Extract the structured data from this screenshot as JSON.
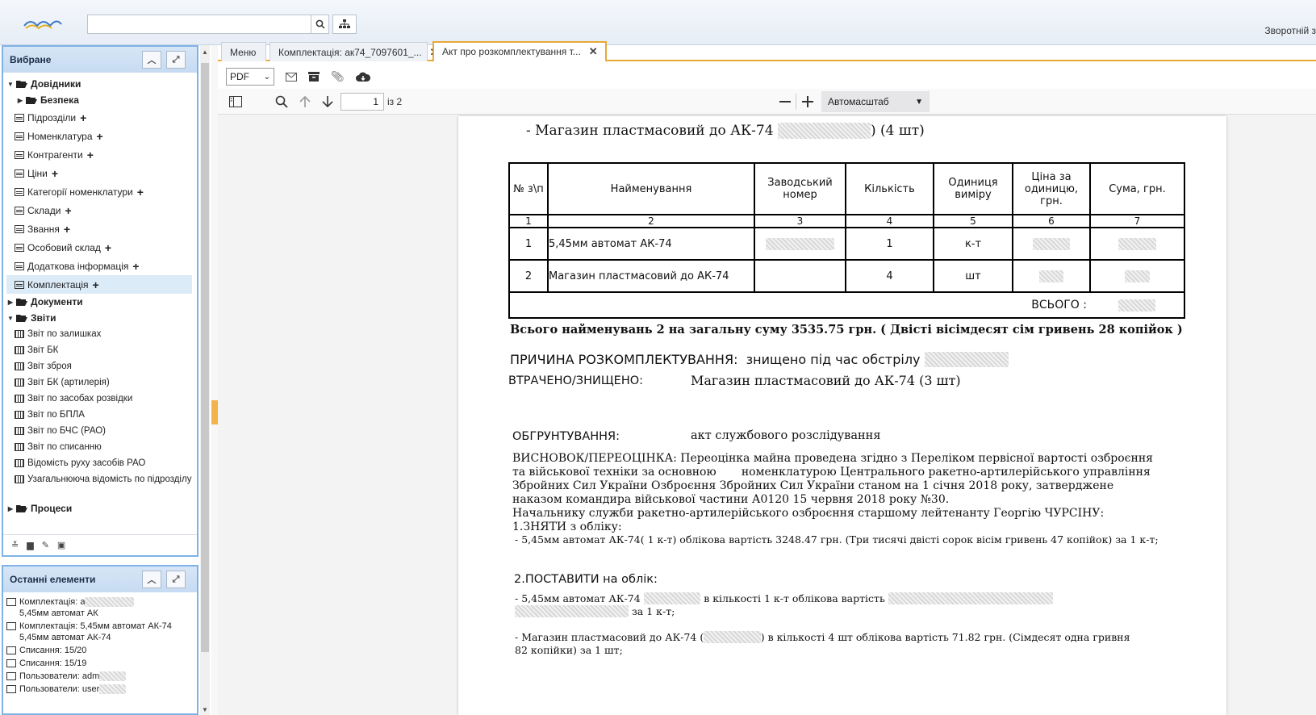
{
  "header": {
    "search_placeholder": "",
    "feedback_label": "Зворотній з"
  },
  "favorites": {
    "title": "Вибране",
    "items": [
      {
        "label": "Довідники"
      },
      {
        "label": "Безпека"
      },
      {
        "label": "Підрозділи"
      },
      {
        "label": "Номенклатура"
      },
      {
        "label": "Контрагенти"
      },
      {
        "label": "Ціни"
      },
      {
        "label": "Категорії номенклатури"
      },
      {
        "label": "Склади"
      },
      {
        "label": "Звання"
      },
      {
        "label": "Особовий склад"
      },
      {
        "label": "Додаткова інформація"
      },
      {
        "label": "Комплектація"
      },
      {
        "label": "Документи"
      },
      {
        "label": "Звіти"
      },
      {
        "label": "Звіт по залишках"
      },
      {
        "label": "Звіт БК"
      },
      {
        "label": "Звіт зброя"
      },
      {
        "label": "Звіт БК (артилерія)"
      },
      {
        "label": "Звіт по засобах розвідки"
      },
      {
        "label": "Звіт по БПЛА"
      },
      {
        "label": "Звіт по БЧС (РАО)"
      },
      {
        "label": "Звіт по списанню"
      },
      {
        "label": "Відомість руху засобів РАО"
      },
      {
        "label": "Узагальнююча відомість по підрозділу"
      },
      {
        "label": "Процеси"
      }
    ]
  },
  "recent": {
    "title": "Останні елементи",
    "items": [
      {
        "line1": "Комплектація: а",
        "line2": "5,45мм автомат АК"
      },
      {
        "line1": "Комплектація: 5,45мм автомат АК-74",
        "line2": "5,45мм автомат АК-74"
      },
      {
        "line1": "Списання: 15/20",
        "line2": ""
      },
      {
        "line1": "Списання: 15/19",
        "line2": ""
      },
      {
        "line1": "Пользователи: adm",
        "line2": ""
      },
      {
        "line1": "Пользователи: user",
        "line2": ""
      }
    ]
  },
  "tabs": [
    {
      "label": "Меню"
    },
    {
      "label": "Комплектація: ак74_7097601_..."
    },
    {
      "label": "Акт про розкомплектування т..."
    }
  ],
  "doc_toolbar": {
    "format": "PDF"
  },
  "pdf_viewer": {
    "page_current": "1",
    "page_total_label": "із 2",
    "zoom_label": "Автомасштаб"
  },
  "document": {
    "top_line": "- Магазин пластмасовий до АК-74",
    "top_line_suffix": ") (4 шт)",
    "table_headers": [
      "№ з\\п",
      "Найменування",
      "Заводський номер",
      "Кількість",
      "Одиниця виміру",
      "Ціна за одиницю, грн.",
      "Сума, грн."
    ],
    "table_numbers": [
      "1",
      "2",
      "3",
      "4",
      "5",
      "6",
      "7"
    ],
    "rows": [
      {
        "n": "1",
        "name": "5,45мм автомат АК-74",
        "qty": "1",
        "unit": "к-т"
      },
      {
        "n": "2",
        "name": "Магазин пластмасовий до АК-74",
        "qty": "4",
        "unit": "шт"
      }
    ],
    "total_label": "ВСЬОГО :",
    "summary": "Всього найменувань 2 на загальну суму 3535.75 грн. ( Двісті вісімдесят сім гривень 28 копійок )",
    "reason_label": "ПРИЧИНА РОЗКОМПЛЕКТУВАННЯ:",
    "reason_value": "знищено під час обстрілу",
    "lost_label": "ВТРАЧЕНО/ЗНИЩЕНО:",
    "lost_value": "Магазин пластмасовий до АК-74  (3 шт)",
    "justify_label": "ОБГРУНТУВАННЯ:",
    "justify_value": "акт службового розслідування",
    "conclusion_lines": [
      "ВИСНОВОК/ПЕРЕОЦІНКА: Переоцінка майна проведена згідно з Переліком первісної вартості озброєння",
      "та військової техніки за основною       номенклатурою Центрального ракетно-артилерійського управління",
      "Збройних Сил України Озброєння Збройних Сил України станом на 1 січня 2018 року, затверджене",
      "наказом командира військової частини А0120 15 червня 2018 року №30.",
      "Начальнику служби ракетно-артилерійського озброєння старшому лейтенанту Георгію ЧУРСІНУ:",
      "1.ЗНЯТИ з обліку:"
    ],
    "remove_line": "- 5,45мм автомат АК-74( 1 к-т) облікова вартість  3248.47 грн. (Три тисячі двісті сорок вісім гривень 47 копійок) за 1 к-т;",
    "put_label": "2.ПОСТАВИТИ на облік:",
    "put_line1_a": "- 5,45мм автомат АК-74",
    "put_line1_b": "в кількості  1 к-т облікова вартість",
    "put_line1_c": "за 1 к-т;",
    "put_line2_a": "- Магазин пластмасовий до АК-74 (",
    "put_line2_b": ") в кількості 4 шт облікова вартість  71.82 грн. (Сімдесят одна гривня",
    "put_line2_c": "82 копійки) за 1 шт;"
  }
}
